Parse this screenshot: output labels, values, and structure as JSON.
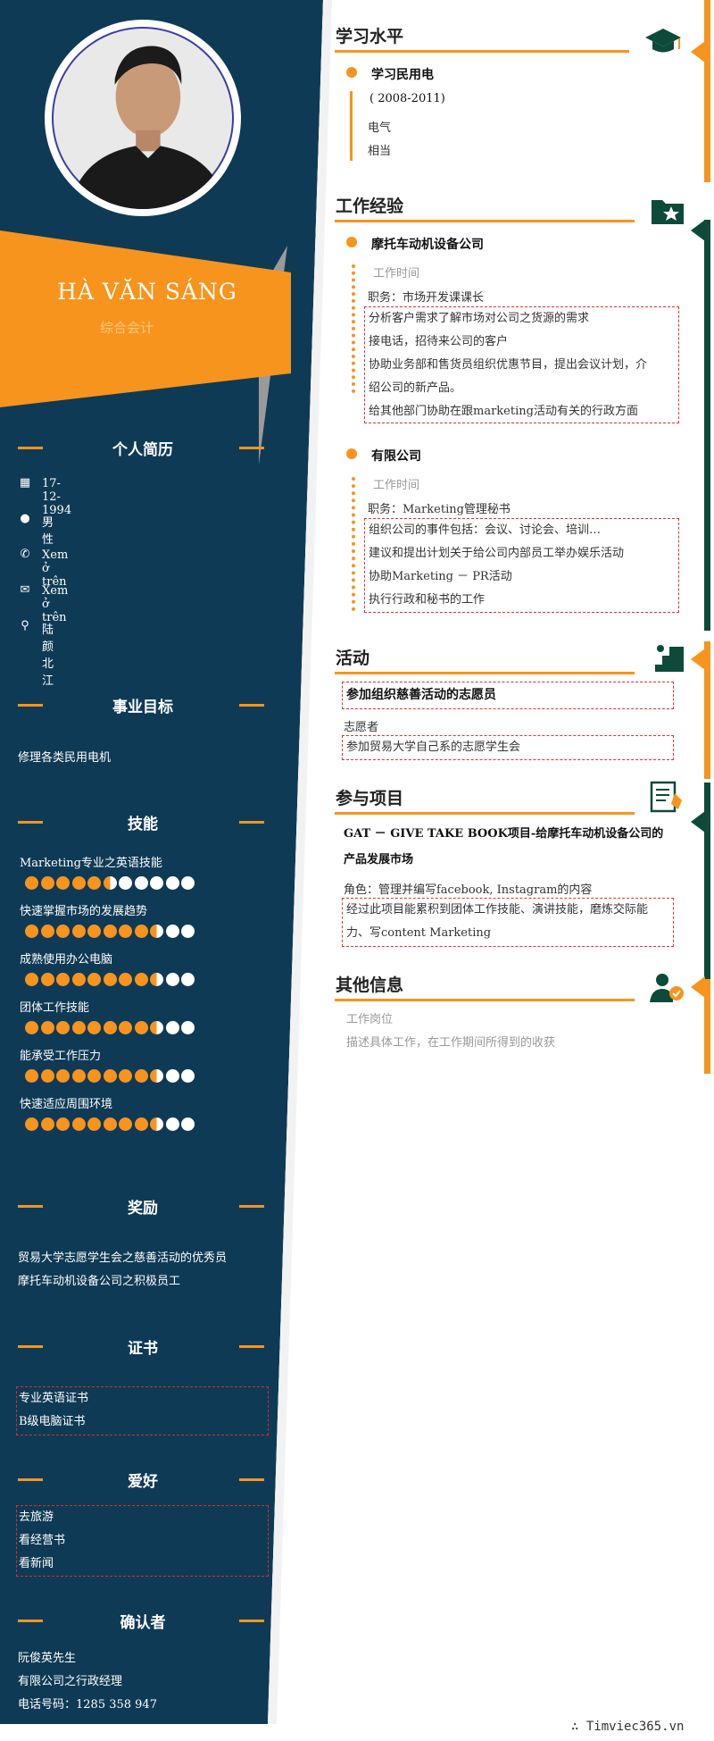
{
  "profile": {
    "name": "HÀ VĂN SÁNG",
    "position": "综合会计"
  },
  "sections": {
    "personal": "个人简历",
    "goal": "事业目标",
    "skills": "技能",
    "awards": "奖励",
    "certs": "证书",
    "hobbies": "爱好",
    "reference": "确认者",
    "education": "学习水平",
    "experience": "工作经验",
    "activities": "活动",
    "projects": "参与项目",
    "other": "其他信息"
  },
  "personal": {
    "birthday": "17-12-1994",
    "gender": "男性",
    "phone": "Xem ở trên",
    "email": "Xem ở trên",
    "address": "陆颜北江"
  },
  "goal_text": "修理各类民用电机",
  "skills": [
    {
      "label": "Marketing专业之英语技能",
      "level": 0.5
    },
    {
      "label": "快速掌握市场的发展趋势",
      "level": 0.8
    },
    {
      "label": "成熟使用办公电脑",
      "level": 0.77
    },
    {
      "label": "团体工作技能",
      "level": 0.77
    },
    {
      "label": "能承受工作压力",
      "level": 0.77
    },
    {
      "label": "快速适应周围环境",
      "level": 0.77
    }
  ],
  "awards": [
    "贸易大学志愿学生会之慈善活动的优秀员",
    "摩托车动机设备公司之积极员工"
  ],
  "certs": [
    "专业英语证书",
    "B级电脑证书"
  ],
  "hobbies": [
    "去旅游",
    "看经营书",
    "看新闻"
  ],
  "reference": [
    "阮俊英先生",
    "有限公司之行政经理",
    "电话号码：1285 358 947"
  ],
  "education": {
    "school": "学习民用电",
    "period": "( 2008-2011)",
    "major": "电气",
    "grade": "相当"
  },
  "experience": [
    {
      "company": "摩托车动机设备公司",
      "time": "工作时间",
      "role": "职务：市场开发课课长",
      "duties": [
        "分析客户需求了解市场对公司之货源的需求",
        "接电话，招待来公司的客户",
        "协助业务部和售货员组织优惠节目，提出会议计划，介",
        "绍公司的新产品。",
        "给其他部门协助在跟marketing活动有关的行政方面"
      ]
    },
    {
      "company": "有限公司",
      "time": "工作时间",
      "role": "职务：Marketing管理秘书",
      "duties": [
        "组织公司的事件包括：会议、讨论会、培训…",
        "建议和提出计划关于给公司内部员工举办娱乐活动",
        "协助Marketing － PR活动",
        "执行行政和秘书的工作"
      ]
    }
  ],
  "activities": {
    "title": "参加组织慈善活动的志愿员",
    "role": "志愿者",
    "desc": "参加贸易大学自己系的志愿学生会"
  },
  "project": {
    "title1": "GAT － GIVE TAKE BOOK项目-给摩托车动机设备公司的",
    "title2": "产品发展市场",
    "role": "角色：管理并编写facebook, Instagram的内容",
    "desc1": "经过此项目能累积到团体工作技能、演讲技能，磨炼交际能",
    "desc2": "力、写content Marketing"
  },
  "other": {
    "title": "工作岗位",
    "desc": "描述具体工作，在工作期间所得到的收获"
  },
  "watermark": "∴ Timviec365.vn",
  "colors": {
    "navy": "#0f3a55",
    "orange": "#f7941d",
    "green": "#0d4a3a"
  }
}
